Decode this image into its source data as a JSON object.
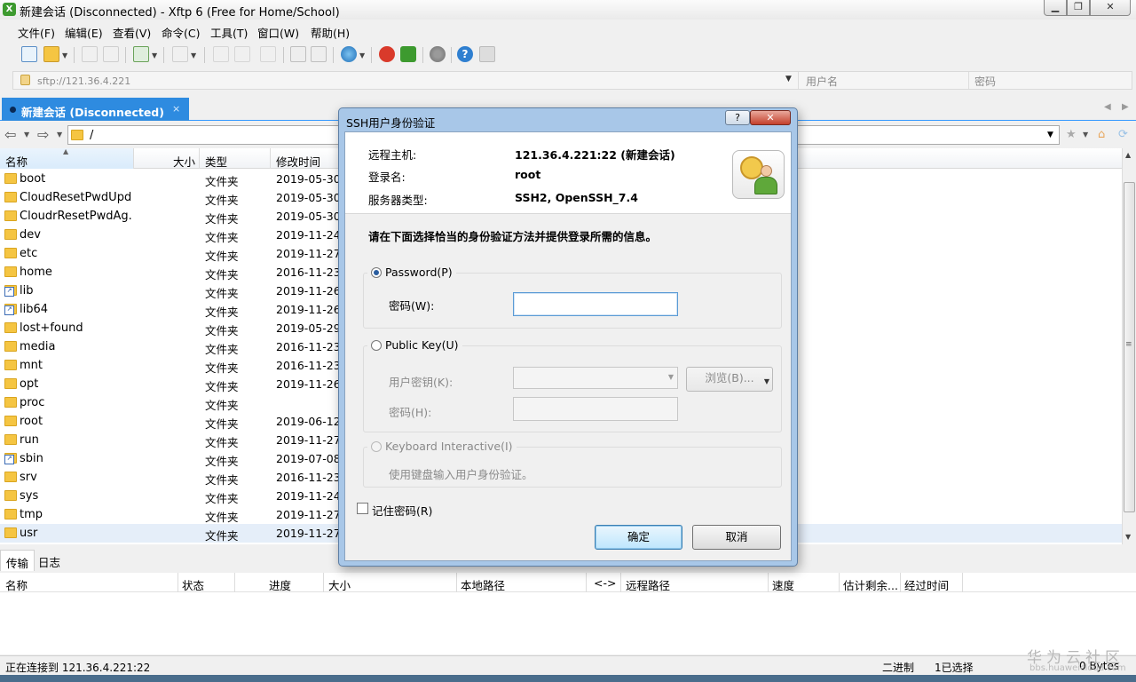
{
  "window": {
    "title": "新建会话 (Disconnected) - Xftp 6 (Free for Home/School)",
    "app_icon_glyph": "X"
  },
  "menu": [
    "文件(F)",
    "编辑(E)",
    "查看(V)",
    "命令(C)",
    "工具(T)",
    "窗口(W)",
    "帮助(H)"
  ],
  "address": {
    "url": "sftp://121.36.4.221",
    "username_placeholder": "用户名",
    "password_placeholder": "密码"
  },
  "session_tab": {
    "label": "新建会话 (Disconnected)",
    "close": "×"
  },
  "path": "/",
  "file_columns": [
    "名称",
    "大小",
    "类型",
    "修改时间"
  ],
  "files": [
    {
      "name": "boot",
      "type": "文件夹",
      "date": "2019-05-30,",
      "link": false
    },
    {
      "name": "CloudResetPwdUpd...",
      "type": "文件夹",
      "date": "2019-05-30,",
      "link": false
    },
    {
      "name": "CloudrResetPwdAg...",
      "type": "文件夹",
      "date": "2019-05-30,",
      "link": false
    },
    {
      "name": "dev",
      "type": "文件夹",
      "date": "2019-11-24,",
      "link": false
    },
    {
      "name": "etc",
      "type": "文件夹",
      "date": "2019-11-27,",
      "link": false
    },
    {
      "name": "home",
      "type": "文件夹",
      "date": "2016-11-23,",
      "link": false
    },
    {
      "name": "lib",
      "type": "文件夹",
      "date": "2019-11-26,",
      "link": true
    },
    {
      "name": "lib64",
      "type": "文件夹",
      "date": "2019-11-26,",
      "link": true
    },
    {
      "name": "lost+found",
      "type": "文件夹",
      "date": "2019-05-29,",
      "link": false
    },
    {
      "name": "media",
      "type": "文件夹",
      "date": "2016-11-23,",
      "link": false
    },
    {
      "name": "mnt",
      "type": "文件夹",
      "date": "2016-11-23,",
      "link": false
    },
    {
      "name": "opt",
      "type": "文件夹",
      "date": "2019-11-26,",
      "link": false
    },
    {
      "name": "proc",
      "type": "文件夹",
      "date": "",
      "link": false
    },
    {
      "name": "root",
      "type": "文件夹",
      "date": "2019-06-12,",
      "link": false
    },
    {
      "name": "run",
      "type": "文件夹",
      "date": "2019-11-27,",
      "link": false
    },
    {
      "name": "sbin",
      "type": "文件夹",
      "date": "2019-07-08,",
      "link": true
    },
    {
      "name": "srv",
      "type": "文件夹",
      "date": "2016-11-23,",
      "link": false
    },
    {
      "name": "sys",
      "type": "文件夹",
      "date": "2019-11-24,",
      "link": false
    },
    {
      "name": "tmp",
      "type": "文件夹",
      "date": "2019-11-27,",
      "link": false
    },
    {
      "name": "usr",
      "type": "文件夹",
      "date": "2019-11-27,",
      "link": false
    }
  ],
  "bottom_tabs": [
    "传输",
    "日志"
  ],
  "transfer_columns": [
    "名称",
    "状态",
    "进度",
    "大小",
    "本地路径",
    "<->",
    "远程路径",
    "速度",
    "估计剩余...",
    "经过时间"
  ],
  "status": {
    "left": "正在连接到 121.36.4.221:22",
    "binary": "二进制",
    "selected": "1已选择",
    "size": "0 Bytes"
  },
  "watermark": {
    "main": "华为云社区",
    "sub": "bbs.huaweicloud.com"
  },
  "dialog": {
    "title": "SSH用户身份验证",
    "help": "?",
    "close": "✕",
    "info": [
      {
        "key": "远程主机:",
        "value": "121.36.4.221:22 (新建会话)"
      },
      {
        "key": "登录名:",
        "value": "root"
      },
      {
        "key": "服务器类型:",
        "value": "SSH2, OpenSSH_7.4"
      }
    ],
    "instruction": "请在下面选择恰当的身份验证方法并提供登录所需的信息。",
    "password_method": {
      "label": "Password(P)",
      "field_label": "密码(W):",
      "value": ""
    },
    "publickey_method": {
      "label": "Public Key(U)",
      "user_key_label": "用户密钥(K):",
      "browse_label": "浏览(B)...",
      "passphrase_label": "密码(H):"
    },
    "keyboard_method": {
      "label": "Keyboard Interactive(I)",
      "description": "使用键盘输入用户身份验证。"
    },
    "remember_label": "记住密码(R)",
    "ok_label": "确定",
    "cancel_label": "取消"
  }
}
